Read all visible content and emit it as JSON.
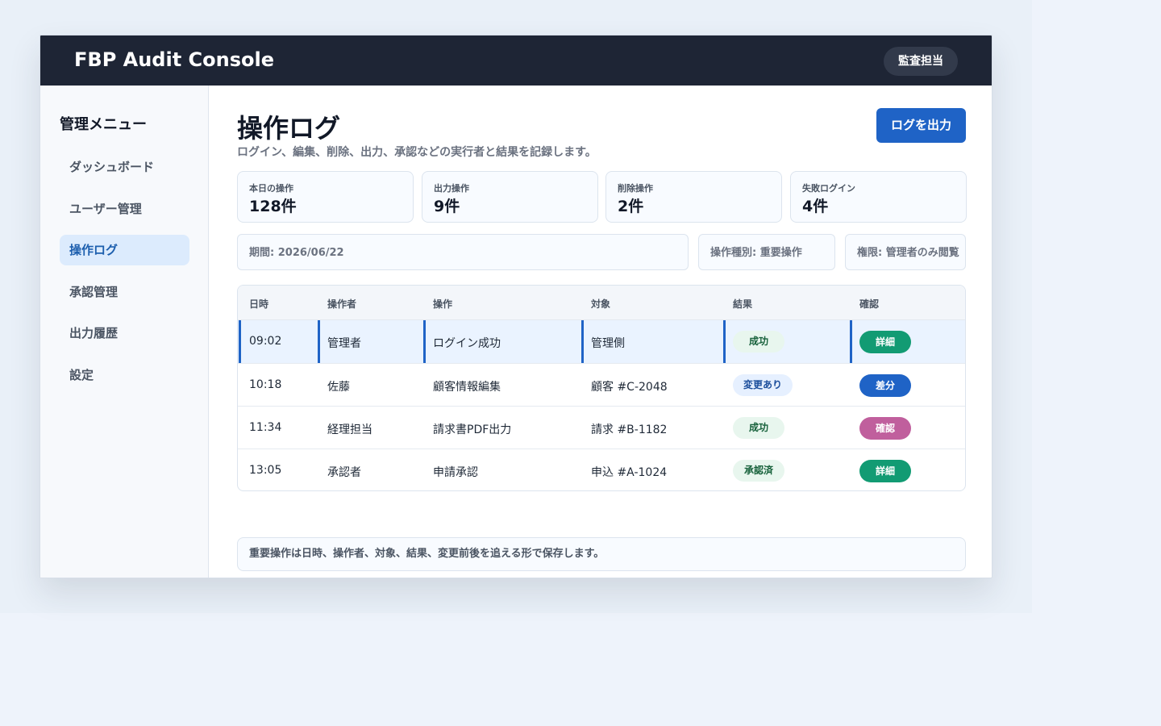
{
  "app": {
    "title": "FBP Audit Console",
    "role": "監査担当"
  },
  "sidebar": {
    "title": "管理メニュー",
    "items": [
      {
        "label": "ダッシュボード",
        "active": false
      },
      {
        "label": "ユーザー管理",
        "active": false
      },
      {
        "label": "操作ログ",
        "active": true
      },
      {
        "label": "承認管理",
        "active": false
      },
      {
        "label": "出力履歴",
        "active": false
      },
      {
        "label": "設定",
        "active": false
      }
    ]
  },
  "page": {
    "title": "操作ログ",
    "description": "ログイン、編集、削除、出力、承認などの実行者と結果を記録します。",
    "export_label": "ログを出力"
  },
  "stats": [
    {
      "label": "本日の操作",
      "value": "128件"
    },
    {
      "label": "出力操作",
      "value": "9件"
    },
    {
      "label": "削除操作",
      "value": "2件"
    },
    {
      "label": "失敗ログイン",
      "value": "4件"
    }
  ],
  "filters": {
    "period": "期間: 2026/06/22",
    "type": "操作種別: 重要操作",
    "permission": "権限: 管理者のみ閲覧"
  },
  "table": {
    "headers": [
      "日時",
      "操作者",
      "操作",
      "対象",
      "結果",
      "確認"
    ],
    "rows": [
      {
        "time": "09:02",
        "actor": "管理者",
        "operation": "ログイン成功",
        "target": "管理側",
        "result": "成功",
        "action": "詳細"
      },
      {
        "time": "10:18",
        "actor": "佐藤",
        "operation": "顧客情報編集",
        "target": "顧客 #C-2048",
        "result": "変更あり",
        "action": "差分"
      },
      {
        "time": "11:34",
        "actor": "経理担当",
        "operation": "請求書PDF出力",
        "target": "請求 #B-1182",
        "result": "成功",
        "action": "確認"
      },
      {
        "time": "13:05",
        "actor": "承認者",
        "operation": "申請承認",
        "target": "申込 #A-1024",
        "result": "承認済",
        "action": "詳細"
      }
    ]
  },
  "note": "重要操作は日時、操作者、対象、結果、変更前後を追える形で保存します。",
  "colors": {
    "header": "#1e2535",
    "accent": "#1f63c6",
    "detail_button": "#129b73",
    "diff_button": "#1f63c6",
    "confirm_button": "#c05f9d"
  }
}
